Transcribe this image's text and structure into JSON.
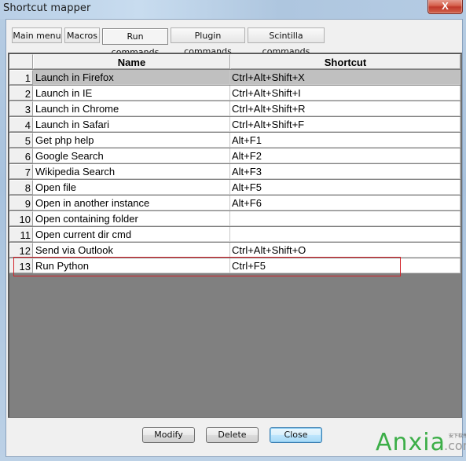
{
  "window": {
    "title": "Shortcut mapper",
    "close_glyph": "X"
  },
  "tabs": [
    {
      "label": "Main menu",
      "active": false
    },
    {
      "label": "Macros",
      "active": false
    },
    {
      "label": "Run commands",
      "active": true
    },
    {
      "label": "Plugin commands",
      "active": false
    },
    {
      "label": "Scintilla commands",
      "active": false
    }
  ],
  "table": {
    "columns": {
      "num": "",
      "name": "Name",
      "shortcut": "Shortcut"
    },
    "rows": [
      {
        "num": "1",
        "name": "Launch in Firefox",
        "shortcut": "Ctrl+Alt+Shift+X",
        "selected": true
      },
      {
        "num": "2",
        "name": "Launch in IE",
        "shortcut": "Ctrl+Alt+Shift+I"
      },
      {
        "num": "3",
        "name": "Launch in Chrome",
        "shortcut": "Ctrl+Alt+Shift+R"
      },
      {
        "num": "4",
        "name": "Launch in Safari",
        "shortcut": "Ctrl+Alt+Shift+F"
      },
      {
        "num": "5",
        "name": "Get php help",
        "shortcut": "Alt+F1"
      },
      {
        "num": "6",
        "name": "Google Search",
        "shortcut": "Alt+F2"
      },
      {
        "num": "7",
        "name": "Wikipedia Search",
        "shortcut": "Alt+F3"
      },
      {
        "num": "8",
        "name": "Open file",
        "shortcut": "Alt+F5"
      },
      {
        "num": "9",
        "name": "Open in another instance",
        "shortcut": "Alt+F6"
      },
      {
        "num": "10",
        "name": "Open containing folder",
        "shortcut": ""
      },
      {
        "num": "11",
        "name": "Open current dir cmd",
        "shortcut": ""
      },
      {
        "num": "12",
        "name": "Send via Outlook",
        "shortcut": "Ctrl+Alt+Shift+O"
      },
      {
        "num": "13",
        "name": "Run Python",
        "shortcut": "Ctrl+F5",
        "highlighted": true
      }
    ]
  },
  "buttons": {
    "modify": "Modify",
    "delete": "Delete",
    "close": "Close"
  },
  "watermark": {
    "text": "Anxia",
    "domain": ".com",
    "tagline": "安下软件站",
    "color": "#3cae48"
  },
  "colors": {
    "highlight_box": "#d2232a",
    "selected_row": "#c0c0c0",
    "grid_background": "#808080"
  }
}
